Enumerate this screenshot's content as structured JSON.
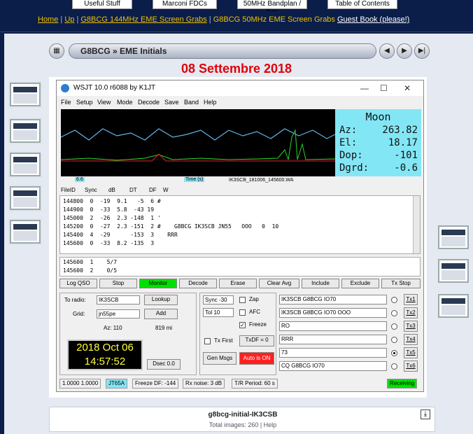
{
  "topnav": {
    "tabs": [
      "Useful Stuff",
      "Marconi FDCs",
      "50MHz Bandplan / Bea",
      "Table of Contents"
    ]
  },
  "breadcrumb": {
    "home": "Home",
    "sep": "|",
    "up": "Up",
    "link1": "G8BCG 144MHz EME Screen Grabs",
    "current": "G8BCG 50MHz EME Screen Grabs",
    "guestbook": "Guest Book (please!)"
  },
  "gallery": {
    "title": "G8BCG » EME Initials",
    "date": "08 Settembre 2018"
  },
  "app": {
    "title": "WSJT 10.0    r6088     by K1JT",
    "menu": [
      "File",
      "Setup",
      "View",
      "Mode",
      "Decode",
      "Save",
      "Band",
      "Help"
    ],
    "moon": {
      "label": "Moon",
      "az_label": "Az:",
      "az": "263.82",
      "el_label": "El:",
      "el": "18.17",
      "dop_label": "Dop:",
      "dop": "-101",
      "dgrd_label": "Dgrd:",
      "dgrd": "-0.6"
    },
    "scale": {
      "left": "6.6",
      "mid": "Time (s)",
      "file": "IK3SCB_181006_145600.WA"
    },
    "header": [
      "FileID",
      "Sync",
      "dB",
      "DT",
      "DF",
      "W"
    ],
    "decodes": [
      "144800  0  -19  9.1   -5  6 #",
      "144900  0  -33  5.8  -43 19",
      "145000  2  -26  2.3 -148  1 '",
      "145200  0  -27  2.3 -151  2 #    G8BCG IK3SCB JN55   OOO   0  10",
      "145400  4  -29      -153  3    RRR",
      "145600  0  -33  8.2 -135  3"
    ],
    "decodes2": [
      "145600  1    5/7",
      "145600  2    0/5"
    ],
    "buttons": [
      "Log QSO",
      "Stop",
      "Monitor",
      "Decode",
      "Erase",
      "Clear Avg",
      "Include",
      "Exclude",
      "Tx Stop"
    ],
    "to_radio_label": "To radio:",
    "to_radio": "IK3SCB",
    "lookup": "Lookup",
    "grid_label": "Grid:",
    "grid": "jn55pe",
    "add": "Add",
    "az": "Az: 110",
    "dist": "819 mi",
    "clock_date": "2018 Oct 06",
    "clock_time": "14:57:52",
    "dsec": "Dsec  0.0",
    "sync": "Sync  -30",
    "zap": "Zap",
    "tol": "Tol   10",
    "afc": "AFC",
    "freeze": "Freeze",
    "txfirst": "Tx First",
    "txdf": "TxDF = 0",
    "genmsgs": "Gen Msgs",
    "autois": "Auto is ON",
    "tx": [
      {
        "msg": "IK3SCB G8BCG IO70",
        "btn": "Tx1"
      },
      {
        "msg": "IK3SCB G8BCG IO70 OOO",
        "btn": "Tx2"
      },
      {
        "msg": "RO",
        "btn": "Tx3"
      },
      {
        "msg": "RRR",
        "btn": "Tx4"
      },
      {
        "msg": "73",
        "btn": "Tx5"
      },
      {
        "msg": "CQ G8BCG IO70",
        "btn": "Tx6"
      }
    ],
    "status": [
      "1.0000 1.0000",
      "JT65A",
      "Freeze DF: -144",
      "Rx noise:  3 dB",
      "T/R Period: 60 s",
      "Receiving"
    ]
  },
  "caption": {
    "name": "g8bcg-initial-IK3CSB",
    "total": "Total images: 260 | Help"
  },
  "colors": {
    "moon_bg": "#83e6f5",
    "monitor": "#00e000",
    "auto": "#ff2020",
    "date": "#e0000a"
  }
}
